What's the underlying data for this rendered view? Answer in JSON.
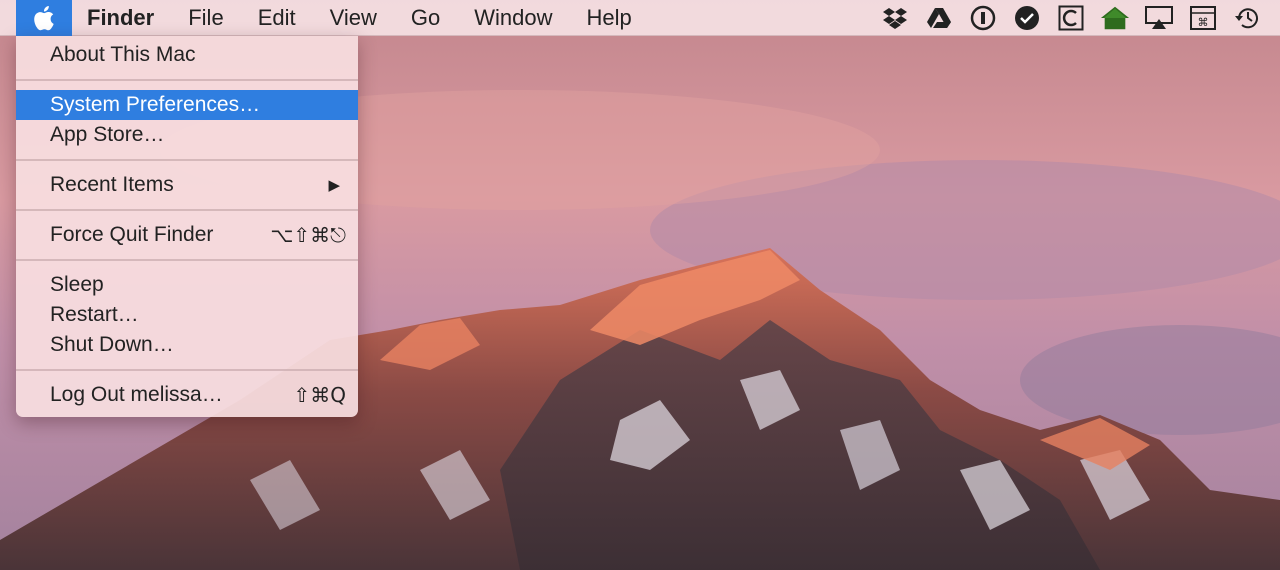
{
  "menubar": {
    "apple_icon": "apple-logo-icon",
    "app_name": "Finder",
    "menus": [
      "File",
      "Edit",
      "View",
      "Go",
      "Window",
      "Help"
    ],
    "status_icons": [
      "dropbox-icon",
      "google-drive-icon",
      "1password-icon",
      "checkmark-circle-icon",
      "c-box-icon",
      "house-icon",
      "airplay-icon",
      "keyboard-shortcuts-icon",
      "time-machine-icon"
    ],
    "colors": {
      "highlight": "#2f7ee0"
    }
  },
  "apple_menu": {
    "about": "About This Mac",
    "system_preferences": "System Preferences…",
    "app_store": "App Store…",
    "recent_items": "Recent Items",
    "recent_items_arrow": "▶",
    "force_quit": "Force Quit Finder",
    "force_quit_shortcut": "⌥⇧⌘⎋",
    "sleep": "Sleep",
    "restart": "Restart…",
    "shut_down": "Shut Down…",
    "log_out": "Log Out melissa…",
    "log_out_shortcut": "⇧⌘Q"
  }
}
